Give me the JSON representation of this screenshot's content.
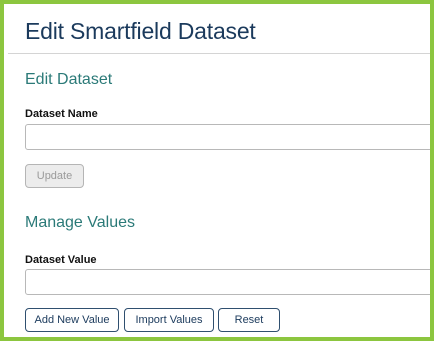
{
  "page": {
    "title": "Edit Smartfield Dataset"
  },
  "edit_section": {
    "title": "Edit Dataset",
    "name_label": "Dataset Name",
    "name_value": "",
    "update_label": "Update"
  },
  "manage_section": {
    "title": "Manage Values",
    "value_label": "Dataset Value",
    "value_value": "",
    "buttons": {
      "add_new": "Add New Value",
      "import": "Import Values",
      "reset": "Reset"
    }
  },
  "colors": {
    "frame_border": "#8cc63f",
    "title": "#1b3a5c",
    "section_title": "#2b7a78",
    "button_border": "#2f4f6f"
  }
}
